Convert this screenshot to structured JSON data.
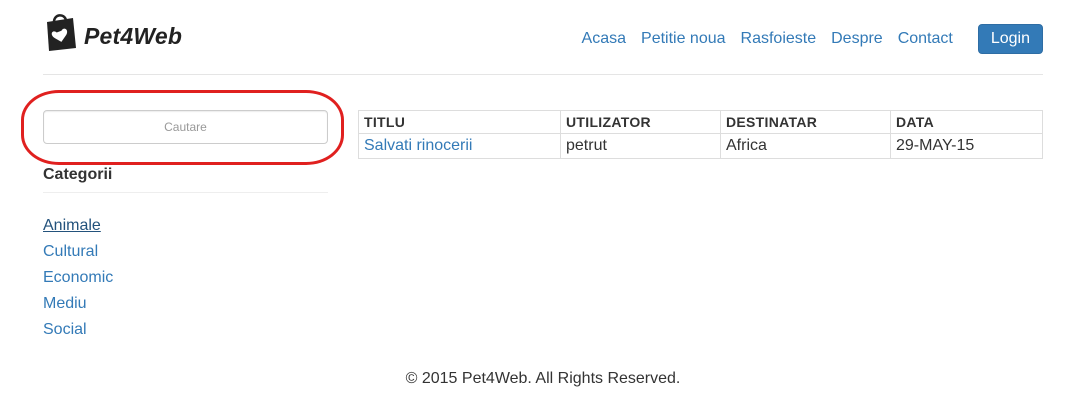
{
  "brand": {
    "name": "Pet4Web",
    "icon": "shopping-bag-heart-icon"
  },
  "nav": {
    "items": [
      "Acasa",
      "Petitie noua",
      "Rasfoieste",
      "Despre",
      "Contact"
    ],
    "login_label": "Login"
  },
  "search": {
    "placeholder": "Cautare",
    "value": ""
  },
  "sidebar": {
    "heading": "Categorii",
    "categories": [
      "Animale",
      "Cultural",
      "Economic",
      "Mediu",
      "Social"
    ],
    "active_category": "Animale"
  },
  "table": {
    "headers": [
      "TITLU",
      "UTILIZATOR",
      "DESTINATAR",
      "DATA"
    ],
    "rows": [
      {
        "title": "Salvati rinocerii",
        "user": "petrut",
        "recipient": "Africa",
        "date": "29-MAY-15"
      }
    ]
  },
  "footer": {
    "text": "© 2015 Pet4Web. All Rights Reserved."
  },
  "colors": {
    "link": "#337ab7",
    "button": "#337ab7",
    "highlight_annotation": "#e0201f"
  }
}
